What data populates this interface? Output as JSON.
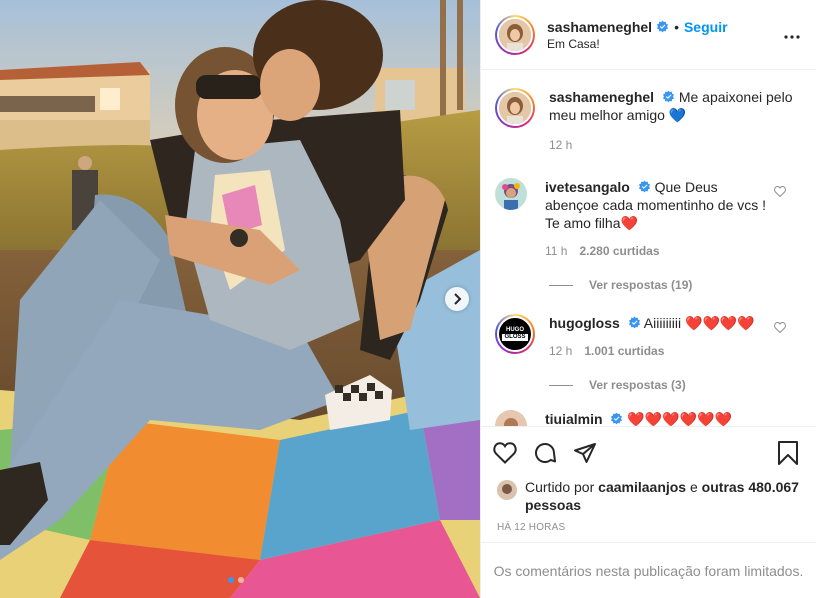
{
  "header": {
    "username": "sashameneghel",
    "separator": "•",
    "follow_label": "Seguir",
    "location": "Em Casa!"
  },
  "caption": {
    "username": "sashameneghel",
    "text": "Me apaixonei pelo meu melhor amigo 💙",
    "time": "12 h"
  },
  "comments": [
    {
      "username": "ivetesangalo",
      "text": "Que Deus abençoe cada momentinho de vcs ! Te amo filha❤️",
      "time": "11 h",
      "likes": "2.280 curtidas",
      "replies": "Ver respostas (19)"
    },
    {
      "username": "hugogloss",
      "text": "Aiiiiiiiii ❤️❤️❤️❤️",
      "time": "12 h",
      "likes": "1.001 curtidas",
      "replies": "Ver respostas (3)",
      "avatar_text_1": "HUGO",
      "avatar_text_2": "GLOSS"
    },
    {
      "username": "tiuialmin",
      "text": "❤️❤️❤️❤️❤️❤️"
    }
  ],
  "liked_by": {
    "prefix": "Curtido por",
    "user": "caamilaanjos",
    "conj": "e",
    "others": "outras 480.067 pessoas"
  },
  "time_ago": "HÁ 12 HORAS",
  "comments_limited": "Os comentários nesta publicação foram limitados.",
  "icons": [
    "verified-badge-icon",
    "more-options-icon",
    "heart-icon",
    "comment-icon",
    "share-icon",
    "save-icon",
    "chevron-right-icon"
  ],
  "colors": {
    "accent": "#0095f6",
    "verified": "#3897f0",
    "heart_red": "#ed4956"
  },
  "carousel": {
    "slides": 2,
    "active": 1
  }
}
